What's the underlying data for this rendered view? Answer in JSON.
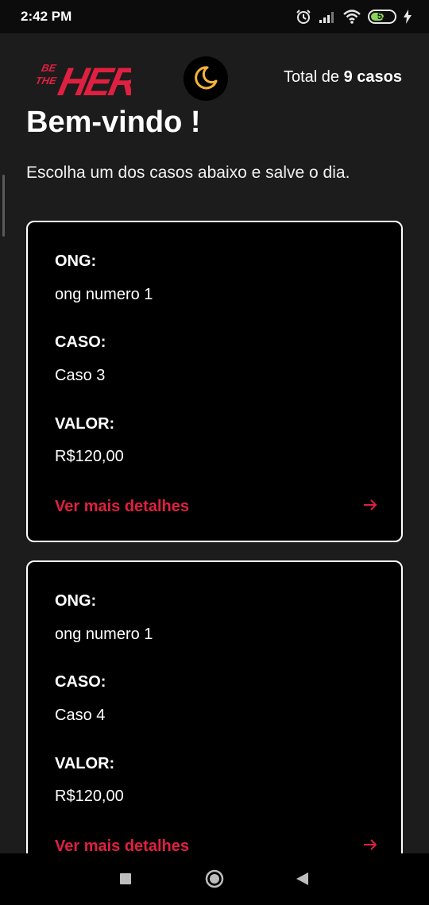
{
  "status_bar": {
    "time": "2:42 PM",
    "battery_level": "52",
    "icons": [
      "alarm-icon",
      "signal-icon",
      "wifi-icon",
      "battery-icon",
      "charging-icon"
    ]
  },
  "header": {
    "logo_text_small": "BE THE",
    "logo_text_big": "HERO",
    "theme_toggle_icon": "moon-icon",
    "total_prefix": "Total de ",
    "total_count": "9 casos"
  },
  "page": {
    "title": "Bem-vindo !",
    "subtitle": "Escolha um dos casos abaixo e salve o dia."
  },
  "cases": [
    {
      "ong_label": "ONG:",
      "ong_value": "ong numero 1",
      "caso_label": "CASO:",
      "caso_value": "Caso 3",
      "valor_label": "VALOR:",
      "valor_value": "R$120,00",
      "details_label": "Ver mais detalhes"
    },
    {
      "ong_label": "ONG:",
      "ong_value": "ong numero 1",
      "caso_label": "CASO:",
      "caso_value": "Caso 4",
      "valor_label": "VALOR:",
      "valor_value": "R$120,00",
      "details_label": "Ver mais detalhes"
    }
  ],
  "colors": {
    "accent": "#e02041",
    "background": "#1c1c1c",
    "card": "#000000",
    "moon": "#f5b436"
  },
  "nav_bar": {
    "icons": [
      "recents-square-icon",
      "home-circle-icon",
      "back-triangle-icon"
    ]
  }
}
